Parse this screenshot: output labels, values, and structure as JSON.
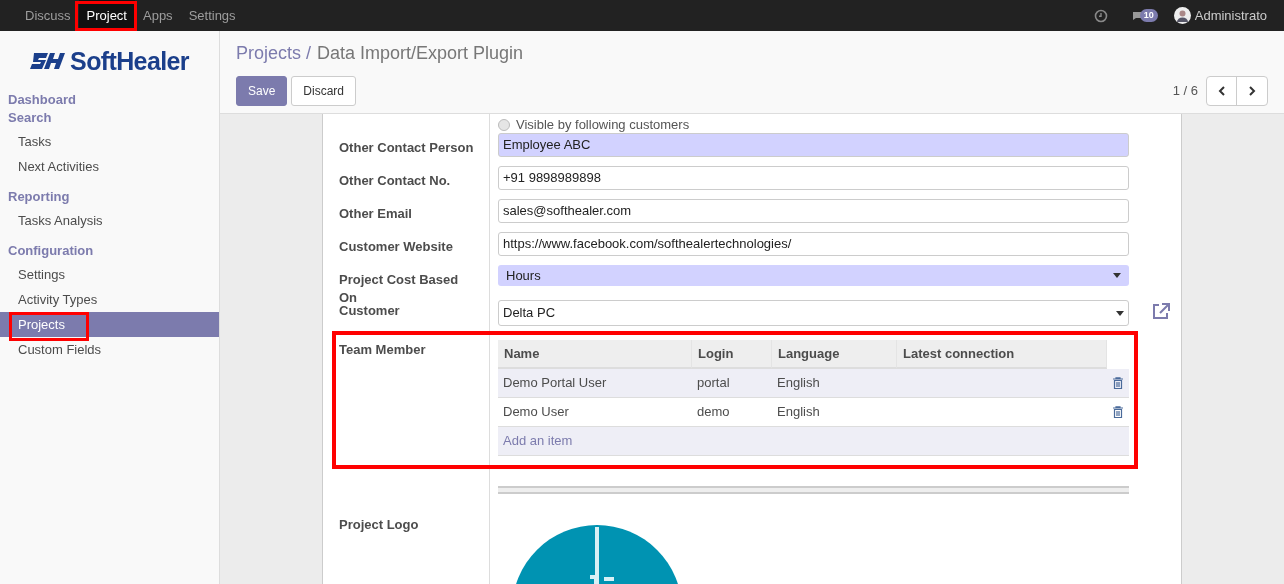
{
  "top_menu": [
    {
      "label": "Discuss",
      "selected": false
    },
    {
      "label": "Project",
      "selected": true
    },
    {
      "label": "Apps",
      "selected": false
    },
    {
      "label": "Settings",
      "selected": false
    }
  ],
  "systray": {
    "message_count": "10",
    "user": "Administrato"
  },
  "sidebar": {
    "brand": "SoftHealer",
    "items": [
      {
        "kind": "heading",
        "label": "Dashboard"
      },
      {
        "kind": "heading",
        "label": "Search"
      },
      {
        "kind": "item",
        "label": "Tasks",
        "selected": false
      },
      {
        "kind": "item",
        "label": "Next Activities",
        "selected": false
      },
      {
        "kind": "heading",
        "label": "Reporting"
      },
      {
        "kind": "item",
        "label": "Tasks Analysis",
        "selected": false
      },
      {
        "kind": "heading",
        "label": "Configuration"
      },
      {
        "kind": "item",
        "label": "Settings",
        "selected": false
      },
      {
        "kind": "item",
        "label": "Activity Types",
        "selected": false
      },
      {
        "kind": "item",
        "label": "Projects",
        "selected": true
      },
      {
        "kind": "item",
        "label": "Custom Fields",
        "selected": false
      }
    ]
  },
  "breadcrumb": [
    "Projects /",
    "Data Import/Export Plugin"
  ],
  "buttons": [
    {
      "label": "Save",
      "kind": "primary"
    },
    {
      "label": "Discard",
      "kind": "secondary"
    }
  ],
  "pager": "1 / 6",
  "form": {
    "radio": {
      "label": "Visible by following customers",
      "checked": false
    },
    "fields": [
      {
        "label": "Other Contact Person",
        "value": "Employee ABC",
        "kind": "input",
        "required": true
      },
      {
        "label": "Other Contact No.",
        "value": "+91 9898989898",
        "kind": "input",
        "required": false
      },
      {
        "label": "Other Email",
        "value": "sales@softhealer.com",
        "kind": "input",
        "required": false
      },
      {
        "label": "Customer Website",
        "value": "https://www.facebook.com/softhealertechnologies/",
        "kind": "input",
        "required": false
      },
      {
        "label": "Project Cost Based On",
        "value": "Hours",
        "kind": "select",
        "required": true
      },
      {
        "label": "Customer",
        "value": "Delta PC",
        "kind": "many2one",
        "required": false
      }
    ],
    "team": {
      "label": "Team Member",
      "columns": [
        "Name",
        "Login",
        "Language",
        "Latest connection"
      ],
      "rows": [
        {
          "cells": [
            "Demo Portal User",
            "portal",
            "English",
            ""
          ],
          "selected": true
        },
        {
          "cells": [
            "Demo User",
            "demo",
            "English",
            ""
          ],
          "selected": false
        }
      ],
      "add_item": "Add an item"
    },
    "logo_label": "Project Logo"
  }
}
